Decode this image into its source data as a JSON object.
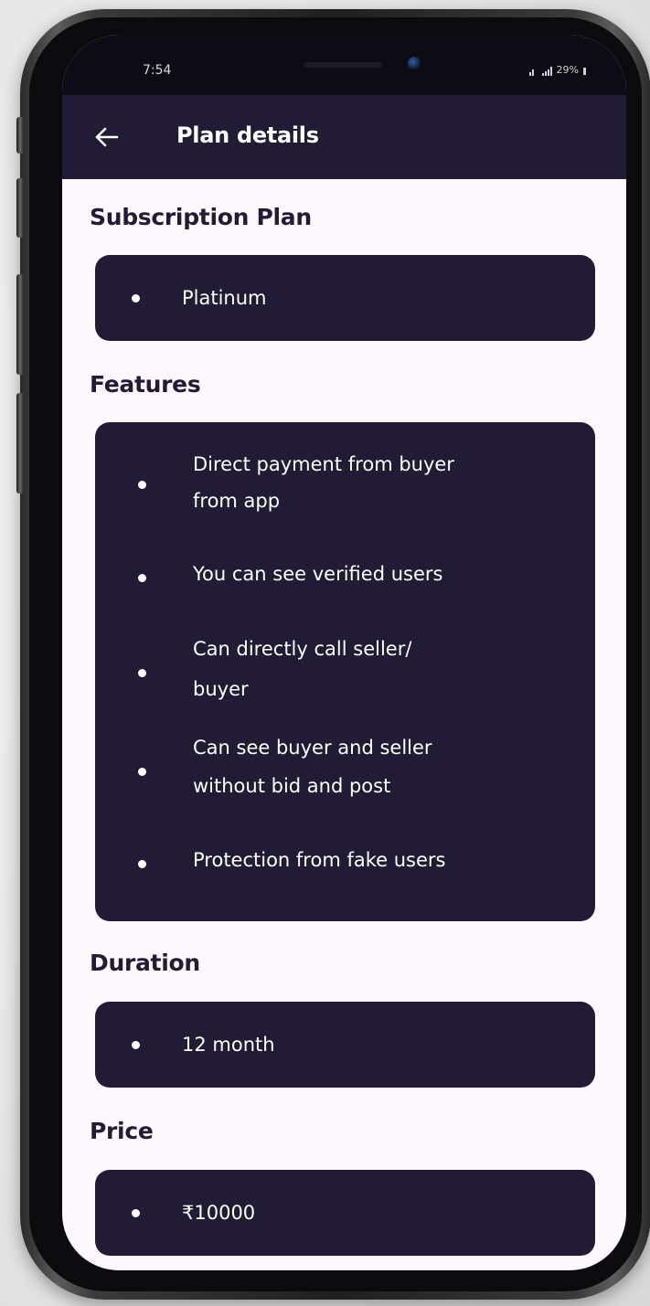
{
  "status_bar": {
    "time": "7:54",
    "battery": "29%"
  },
  "header": {
    "title": "Plan details",
    "back_icon": "arrow-left-icon"
  },
  "sections": {
    "subscription": {
      "heading": "Subscription Plan",
      "value": "Platinum"
    },
    "features": {
      "heading": "Features",
      "items": [
        {
          "line1": "Direct payment from buyer",
          "line2": "from app"
        },
        {
          "line1": "You can see verified users",
          "line2": ""
        },
        {
          "line1": "Can directly call seller/",
          "line2": "buyer"
        },
        {
          "line1": "Can see buyer and seller",
          "line2": "without bid and post"
        },
        {
          "line1": "Protection from fake users",
          "line2": ""
        }
      ]
    },
    "duration": {
      "heading": "Duration",
      "value": "12 month"
    },
    "price": {
      "heading": "Price",
      "value": "₹10000"
    }
  },
  "colors": {
    "primary": "#221b35",
    "background": "#fcf8fc",
    "text_on_primary": "#ffffff"
  }
}
